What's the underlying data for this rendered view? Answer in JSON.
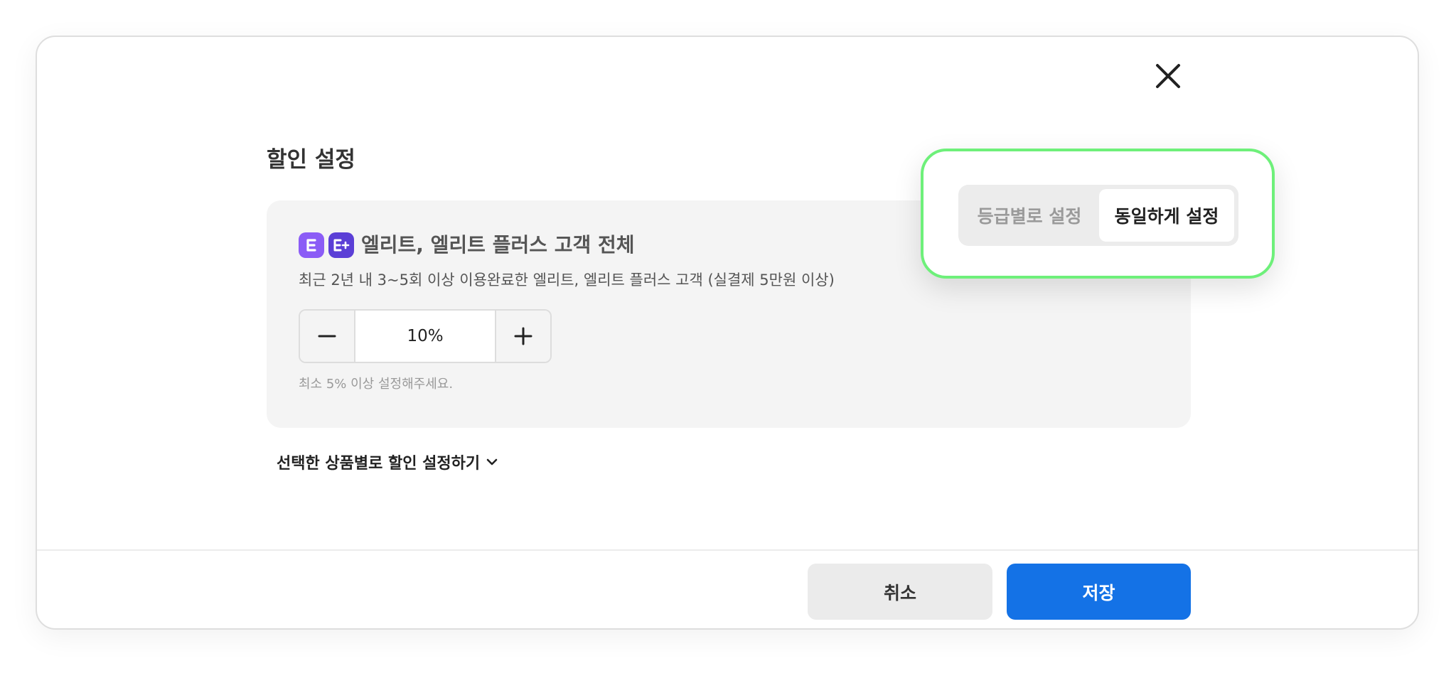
{
  "dialog": {
    "title": "할인 설정",
    "close_icon": "close-icon"
  },
  "segment": {
    "options": [
      "등급별로 설정",
      "동일하게 설정"
    ],
    "selected": "동일하게 설정"
  },
  "discount_group": {
    "badges": [
      {
        "icon": "elite-badge-icon",
        "color": "#8b5cf6"
      },
      {
        "icon": "elite-plus-badge-icon",
        "color": "#5b3fd6"
      }
    ],
    "title": "엘리트, 엘리트 플러스 고객 전체",
    "description": "최근 2년 내 3~5회 이상 이용완료한 엘리트, 엘리트 플러스 고객 (실결제 5만원 이상)",
    "stepper": {
      "value": "10%",
      "minus_icon": "minus-icon",
      "plus_icon": "plus-icon"
    },
    "hint": "최소 5% 이상 설정해주세요."
  },
  "per_product_toggle": {
    "label": "선택한 상품별로 할인 설정하기",
    "icon": "chevron-down-icon"
  },
  "footer": {
    "cancel_label": "취소",
    "save_label": "저장"
  },
  "colors": {
    "primary": "#1472e6",
    "highlight": "#6ef07a",
    "panel_bg": "#f4f4f4"
  }
}
